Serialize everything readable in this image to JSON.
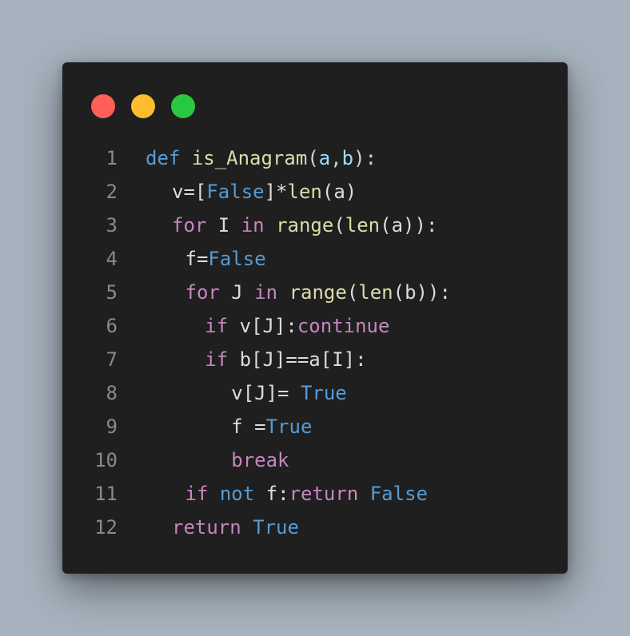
{
  "window": {
    "traffic_lights": [
      {
        "name": "close",
        "color": "#ff5f57"
      },
      {
        "name": "minimize",
        "color": "#febc2e"
      },
      {
        "name": "maximize",
        "color": "#28c840"
      }
    ]
  },
  "colors": {
    "background": "#a6b2bd",
    "editor": "#1f1f1f",
    "line_number": "#8a8a8a",
    "keyword": "#569cd6",
    "control": "#c586c0",
    "function": "#dcdcaa",
    "identifier": "#dcdcdc",
    "parameter": "#9cdcfe"
  },
  "code": {
    "language": "python",
    "lines": [
      {
        "number": "1",
        "indent": 0,
        "tokens": [
          {
            "t": "def",
            "c": "kw"
          },
          {
            "t": " ",
            "c": "pun"
          },
          {
            "t": "is_Anagram",
            "c": "fn"
          },
          {
            "t": "(",
            "c": "pun"
          },
          {
            "t": "a",
            "c": "par"
          },
          {
            "t": ",",
            "c": "pun"
          },
          {
            "t": "b",
            "c": "par"
          },
          {
            "t": "):",
            "c": "pun"
          }
        ]
      },
      {
        "number": "2",
        "indent": 2,
        "tokens": [
          {
            "t": "v=[",
            "c": "id"
          },
          {
            "t": "False",
            "c": "kw"
          },
          {
            "t": "]*",
            "c": "id"
          },
          {
            "t": "len",
            "c": "fn"
          },
          {
            "t": "(a)",
            "c": "id"
          }
        ]
      },
      {
        "number": "3",
        "indent": 2,
        "tokens": [
          {
            "t": "for",
            "c": "ctl"
          },
          {
            "t": " I ",
            "c": "id"
          },
          {
            "t": "in",
            "c": "ctl"
          },
          {
            "t": " ",
            "c": "id"
          },
          {
            "t": "range",
            "c": "fn"
          },
          {
            "t": "(",
            "c": "id"
          },
          {
            "t": "len",
            "c": "fn"
          },
          {
            "t": "(a)):",
            "c": "id"
          }
        ]
      },
      {
        "number": "4",
        "indent": 3,
        "tokens": [
          {
            "t": "f=",
            "c": "id"
          },
          {
            "t": "False",
            "c": "kw"
          }
        ]
      },
      {
        "number": "5",
        "indent": 3,
        "tokens": [
          {
            "t": "for",
            "c": "ctl"
          },
          {
            "t": " J ",
            "c": "id"
          },
          {
            "t": "in",
            "c": "ctl"
          },
          {
            "t": " ",
            "c": "id"
          },
          {
            "t": "range",
            "c": "fn"
          },
          {
            "t": "(",
            "c": "id"
          },
          {
            "t": "len",
            "c": "fn"
          },
          {
            "t": "(b)):",
            "c": "id"
          }
        ]
      },
      {
        "number": "6",
        "indent": 4.5,
        "tokens": [
          {
            "t": "if",
            "c": "ctl"
          },
          {
            "t": " v[J]:",
            "c": "id"
          },
          {
            "t": "continue",
            "c": "ctl"
          }
        ]
      },
      {
        "number": "7",
        "indent": 4.5,
        "tokens": [
          {
            "t": "if",
            "c": "ctl"
          },
          {
            "t": " b[J]==a[I]:",
            "c": "id"
          }
        ]
      },
      {
        "number": "8",
        "indent": 6.5,
        "tokens": [
          {
            "t": "v[J]= ",
            "c": "id"
          },
          {
            "t": "True",
            "c": "kw"
          }
        ]
      },
      {
        "number": "9",
        "indent": 6.5,
        "tokens": [
          {
            "t": "f =",
            "c": "id"
          },
          {
            "t": "True",
            "c": "kw"
          }
        ]
      },
      {
        "number": "10",
        "indent": 6.5,
        "tokens": [
          {
            "t": "break",
            "c": "ctl"
          }
        ]
      },
      {
        "number": "11",
        "indent": 3,
        "tokens": [
          {
            "t": "if",
            "c": "ctl"
          },
          {
            "t": " ",
            "c": "id"
          },
          {
            "t": "not",
            "c": "kw"
          },
          {
            "t": " f:",
            "c": "id"
          },
          {
            "t": "return",
            "c": "ctl"
          },
          {
            "t": " ",
            "c": "id"
          },
          {
            "t": "False",
            "c": "kw"
          }
        ]
      },
      {
        "number": "12",
        "indent": 2,
        "tokens": [
          {
            "t": "return",
            "c": "ctl"
          },
          {
            "t": " ",
            "c": "id"
          },
          {
            "t": "True",
            "c": "kw"
          }
        ]
      }
    ]
  }
}
